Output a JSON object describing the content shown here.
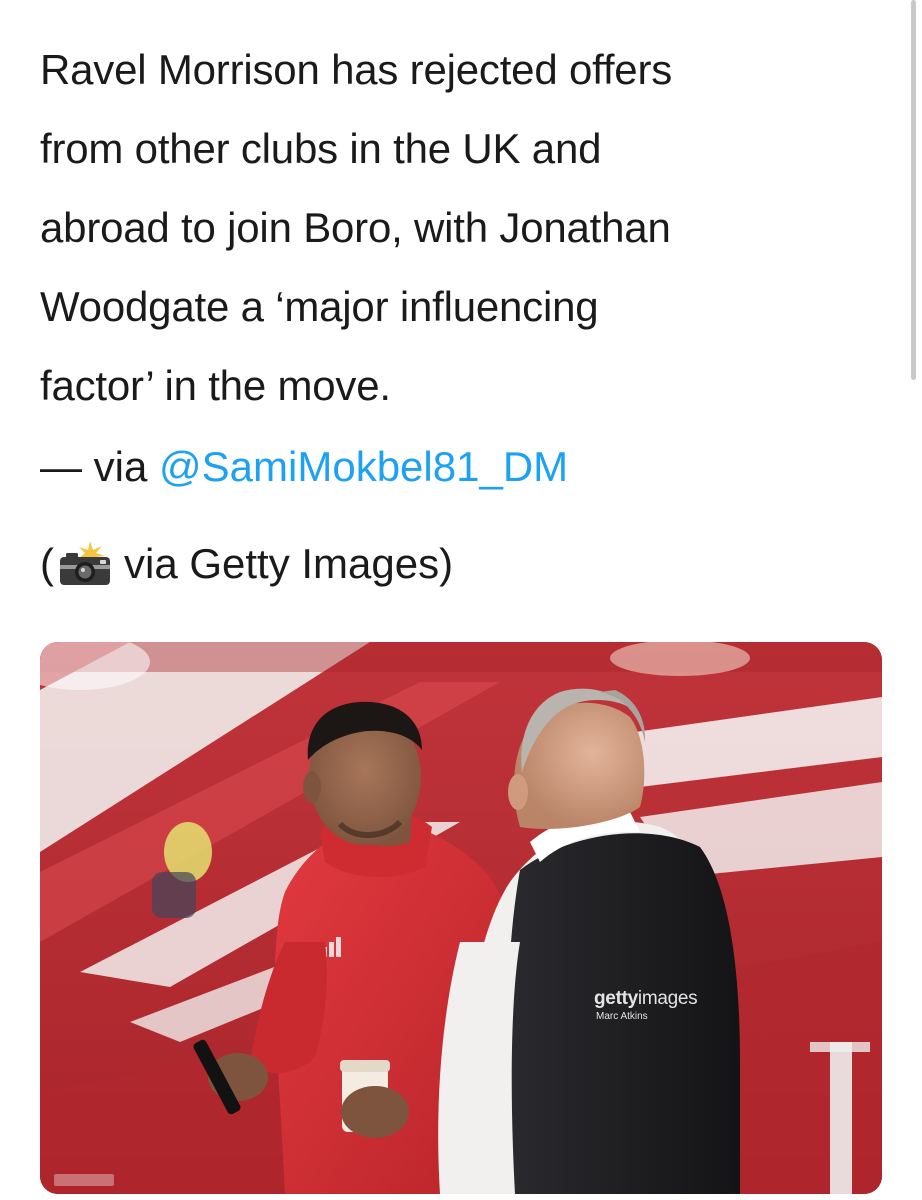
{
  "tweet": {
    "lines": [
      "Ravel Morrison has rejected offers",
      "from other clubs in the UK and",
      "abroad to join Boro, with Jonathan",
      "Woodgate a ‘major influencing",
      "factor’ in the move."
    ],
    "via_prefix": "— via ",
    "mention": "@SamiMokbel81_DM",
    "credit_open": "(",
    "credit_icon": "camera-with-flash-icon",
    "credit_text": "via Getty Images)"
  },
  "media": {
    "watermark_brand_bold": "getty",
    "watermark_brand_light": "images",
    "watermark_photographer": "Marc Atkins"
  },
  "colors": {
    "mention": "#1da1f2",
    "text": "#1a1a1a",
    "stadium_red": "#b52a2f"
  }
}
